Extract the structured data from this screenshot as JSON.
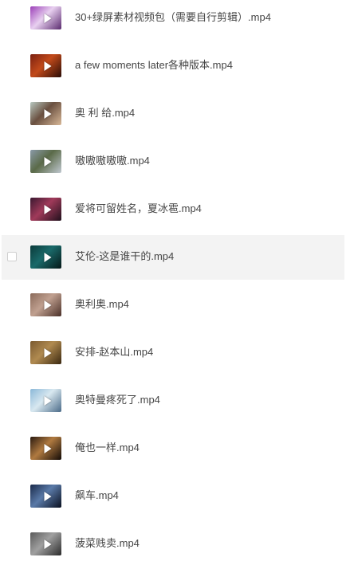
{
  "files": [
    {
      "name": "30+绿屏素材视频包（需要自行剪辑）.mp4",
      "thumb_icon": "video-thumbnail",
      "thumb_colors": [
        "#9b3fb8",
        "#e8d0f0",
        "#5a2a6e"
      ]
    },
    {
      "name": "a few moments later各种版本.mp4",
      "thumb_icon": "video-thumbnail",
      "thumb_colors": [
        "#7a2010",
        "#c24a1a",
        "#2a0c06"
      ]
    },
    {
      "name": "奥 利 给.mp4",
      "thumb_icon": "video-thumbnail",
      "thumb_colors": [
        "#b8c8c0",
        "#6a5040",
        "#d8b898"
      ]
    },
    {
      "name": "嗷嗷嗷嗷嗷.mp4",
      "thumb_icon": "video-thumbnail",
      "thumb_colors": [
        "#8a9aa8",
        "#5a6a48",
        "#c0c8d0"
      ]
    },
    {
      "name": "爱将可留姓名，夏冰雹.mp4",
      "thumb_icon": "video-thumbnail",
      "thumb_colors": [
        "#3a1830",
        "#a03a5a",
        "#20101c"
      ]
    },
    {
      "name": "艾伦-这是谁干的.mp4",
      "thumb_icon": "video-thumbnail",
      "thumb_colors": [
        "#0a3a3a",
        "#1a6a6a",
        "#051818"
      ]
    },
    {
      "name": "奥利奥.mp4",
      "thumb_icon": "video-thumbnail",
      "thumb_colors": [
        "#8a6a5a",
        "#c0a090",
        "#4a3028"
      ]
    },
    {
      "name": "安排-赵本山.mp4",
      "thumb_icon": "video-thumbnail",
      "thumb_colors": [
        "#7a5a30",
        "#b08a50",
        "#3a2810"
      ]
    },
    {
      "name": "奥特曼疼死了.mp4",
      "thumb_icon": "video-thumbnail",
      "thumb_colors": [
        "#8ab8d8",
        "#d8e8f0",
        "#4a6a88"
      ]
    },
    {
      "name": "俺也一样.mp4",
      "thumb_icon": "video-thumbnail",
      "thumb_colors": [
        "#2a1a10",
        "#b07a40",
        "#120a06"
      ]
    },
    {
      "name": "飙车.mp4",
      "thumb_icon": "video-thumbnail",
      "thumb_colors": [
        "#1a2a4a",
        "#5a7aa8",
        "#0a1020"
      ]
    },
    {
      "name": "菠菜贱卖.mp4",
      "thumb_icon": "video-thumbnail",
      "thumb_colors": [
        "#5a5a5a",
        "#a0a0a0",
        "#2a2a2a"
      ]
    }
  ],
  "hovered_index": 5,
  "colors": {
    "hover_background": "#f3f3f3",
    "text": "#454545"
  }
}
